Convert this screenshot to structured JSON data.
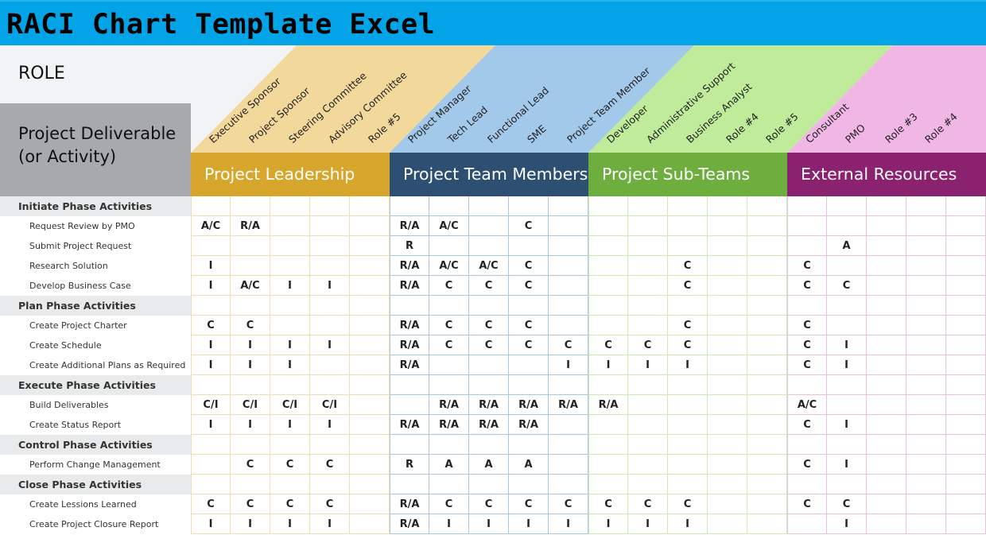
{
  "title": "RACI Chart Template Excel",
  "role_label": "ROLE",
  "deliverable_label_1": "Project Deliverable",
  "deliverable_label_2": "(or Activity)",
  "groups": [
    {
      "name": "Project Leadership",
      "band_color": "#d6a72c",
      "header_color": "#f3d89c",
      "grid_color": "#f0dfae",
      "roles": [
        "Executive Sponsor",
        "Project Sponsor",
        "Steering Committee",
        "Advisory Committee",
        "Role #5"
      ]
    },
    {
      "name": "Project Team Members",
      "band_color": "#2d5072",
      "header_color": "#a2c8ea",
      "grid_color": "#a9c6de",
      "roles": [
        "Project Manager",
        "Tech Lead",
        "Functional Lead",
        "SME",
        "Project Team Member"
      ]
    },
    {
      "name": "Project Sub-Teams",
      "band_color": "#6eae3f",
      "header_color": "#bfeb9a",
      "grid_color": "#cdeaaf",
      "roles": [
        "Developer",
        "Administrative Support",
        "Business Analyst",
        "Role #4",
        "Role #5"
      ]
    },
    {
      "name": "External Resources",
      "band_color": "#8b2270",
      "header_color": "#f0b7e4",
      "grid_color": "#e4c3e1",
      "roles": [
        "Consultant",
        "PMO",
        "Role #3",
        "Role #4",
        ""
      ]
    }
  ],
  "rows": [
    {
      "label": "Initiate Phase Activities",
      "type": "section",
      "cells": []
    },
    {
      "label": "Request Review by PMO",
      "type": "item",
      "cells": [
        "A/C",
        "R/A",
        "",
        "",
        "",
        "R/A",
        "A/C",
        "",
        "C",
        "",
        "",
        "",
        "",
        "",
        "",
        "",
        "",
        "",
        "",
        ""
      ]
    },
    {
      "label": "Submit Project Request",
      "type": "item",
      "cells": [
        "",
        "",
        "",
        "",
        "",
        "R",
        "",
        "",
        "",
        "",
        "",
        "",
        "",
        "",
        "",
        "",
        "A",
        "",
        "",
        ""
      ]
    },
    {
      "label": "Research Solution",
      "type": "item",
      "cells": [
        "I",
        "",
        "",
        "",
        "",
        "R/A",
        "A/C",
        "A/C",
        "C",
        "",
        "",
        "",
        "C",
        "",
        "",
        "C",
        "",
        "",
        "",
        ""
      ]
    },
    {
      "label": "Develop Business Case",
      "type": "item",
      "cells": [
        "I",
        "A/C",
        "I",
        "I",
        "",
        "R/A",
        "C",
        "C",
        "C",
        "",
        "",
        "",
        "C",
        "",
        "",
        "C",
        "C",
        "",
        "",
        ""
      ]
    },
    {
      "label": "Plan Phase Activities",
      "type": "section",
      "cells": []
    },
    {
      "label": "Create Project Charter",
      "type": "item",
      "cells": [
        "C",
        "C",
        "",
        "",
        "",
        "R/A",
        "C",
        "C",
        "C",
        "",
        "",
        "",
        "C",
        "",
        "",
        "C",
        "",
        "",
        "",
        ""
      ]
    },
    {
      "label": "Create Schedule",
      "type": "item",
      "cells": [
        "I",
        "I",
        "I",
        "I",
        "",
        "R/A",
        "C",
        "C",
        "C",
        "C",
        "C",
        "C",
        "C",
        "",
        "",
        "C",
        "I",
        "",
        "",
        ""
      ]
    },
    {
      "label": "Create Additional Plans as Required",
      "type": "item",
      "cells": [
        "I",
        "I",
        "I",
        "",
        "",
        "R/A",
        "",
        "",
        "",
        "I",
        "I",
        "I",
        "I",
        "",
        "",
        "C",
        "I",
        "",
        "",
        ""
      ]
    },
    {
      "label": "Execute Phase Activities",
      "type": "section",
      "cells": []
    },
    {
      "label": "Build Deliverables",
      "type": "item",
      "cells": [
        "C/I",
        "C/I",
        "C/I",
        "C/I",
        "",
        "",
        "R/A",
        "R/A",
        "R/A",
        "R/A",
        "R/A",
        "",
        "",
        "",
        "",
        "A/C",
        "",
        "",
        "",
        ""
      ]
    },
    {
      "label": "Create Status Report",
      "type": "item",
      "cells": [
        "I",
        "I",
        "I",
        "I",
        "",
        "R/A",
        "R/A",
        "R/A",
        "R/A",
        "",
        "",
        "",
        "",
        "",
        "",
        "C",
        "I",
        "",
        "",
        ""
      ]
    },
    {
      "label": "Control Phase Activities",
      "type": "section",
      "cells": []
    },
    {
      "label": "Perform Change Management",
      "type": "item",
      "cells": [
        "",
        "C",
        "C",
        "C",
        "",
        "R",
        "A",
        "A",
        "A",
        "",
        "",
        "",
        "",
        "",
        "",
        "C",
        "I",
        "",
        "",
        ""
      ]
    },
    {
      "label": "Close Phase Activities",
      "type": "section",
      "cells": []
    },
    {
      "label": "Create Lessions Learned",
      "type": "item",
      "cells": [
        "C",
        "C",
        "C",
        "C",
        "",
        "R/A",
        "C",
        "C",
        "C",
        "C",
        "C",
        "C",
        "C",
        "",
        "",
        "C",
        "C",
        "",
        "",
        ""
      ]
    },
    {
      "label": "Create Project Closure Report",
      "type": "item",
      "cells": [
        "I",
        "I",
        "I",
        "I",
        "",
        "R/A",
        "I",
        "I",
        "I",
        "I",
        "I",
        "I",
        "I",
        "",
        "",
        "",
        "I",
        "",
        "",
        ""
      ]
    }
  ],
  "colors": {
    "title_bar": "#03a3e8",
    "header_bg": "#f1f3f4",
    "deliverable_box": "#a7a9ac",
    "section_bg": "#e9eaeb"
  }
}
